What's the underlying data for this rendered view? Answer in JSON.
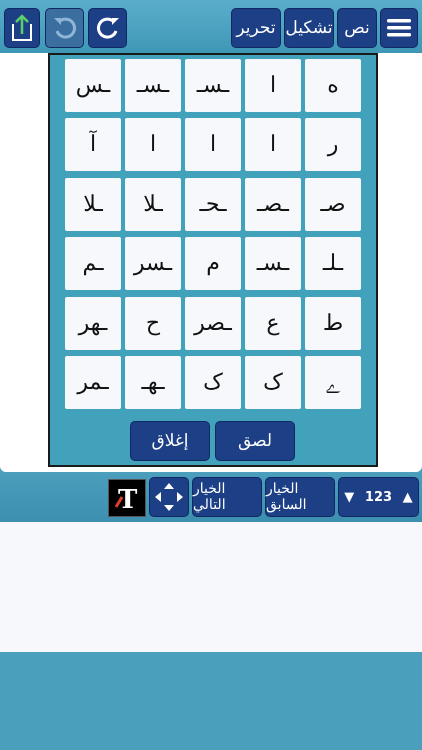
{
  "toolbar": {
    "menu_icon": "hamburger-menu-icon",
    "text_tab": "نص",
    "tashkeel_tab": "تشكيل",
    "edit_tab": "تحرير",
    "redo_icon": "redo-icon",
    "undo_icon": "undo-icon",
    "share_icon": "share-export-icon"
  },
  "palette": {
    "rows": [
      [
        "ﻩ",
        "ا",
        "ـسـ",
        "ـسـ",
        "ـس"
      ],
      [
        "ر",
        "ا",
        "ا",
        "ا",
        "آ"
      ],
      [
        "صـ",
        "ـصـ",
        "ـحـ",
        "ـلا",
        "ـلا"
      ],
      [
        "ـلـ",
        "ـسـ",
        "م",
        "ـسر",
        "ـم"
      ],
      [
        "ط",
        "ع",
        "ـصر",
        "ح",
        "ـهر"
      ],
      [
        "ﮮ",
        "ک",
        "ک",
        "ـهـ",
        "ـمر"
      ]
    ],
    "paste_label": "لصق",
    "close_label": "إغلاق"
  },
  "bottombar": {
    "up_arrow": "▲",
    "counter": "123",
    "down_arrow": "▼",
    "prev_label": "الخيار السابق",
    "next_label": "الخيار التالي",
    "move_icon": "four-way-arrows-icon",
    "font_icon": "text-font-icon"
  },
  "colors": {
    "accent": "#4a9fbd",
    "button": "#1c3f86",
    "panel": "#43a2bb"
  }
}
